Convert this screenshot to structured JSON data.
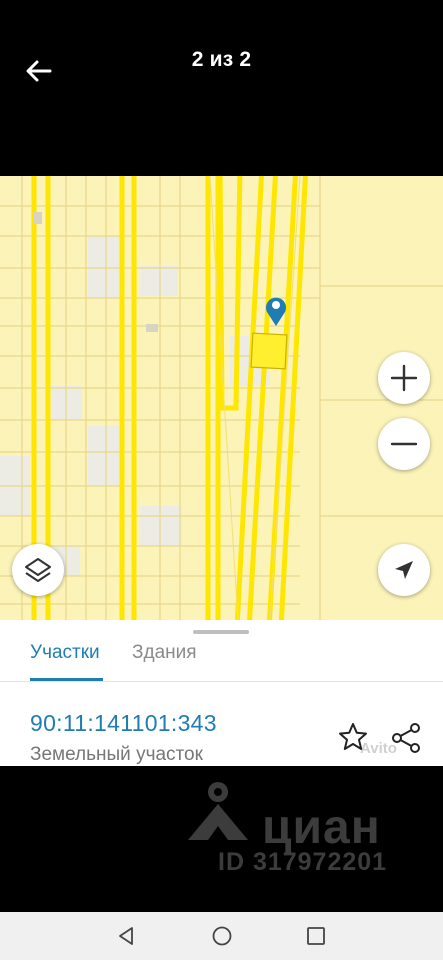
{
  "header": {
    "counter": "2 из 2",
    "back_icon": "arrow-left-icon"
  },
  "map": {
    "controls": {
      "zoom_in_icon": "plus-icon",
      "zoom_out_icon": "minus-icon",
      "layers_icon": "layers-icon",
      "locate_icon": "navigation-arrow-icon"
    },
    "marker_icon": "map-pin-icon",
    "colors": {
      "background": "#fbf3b8",
      "road_border": "#ffe600",
      "parcel_line": "#e9d98c",
      "marker": "#1f7db4",
      "selected_plot": "#ffef2e"
    }
  },
  "sheet": {
    "tabs": [
      {
        "label": "Участки",
        "active": true
      },
      {
        "label": "Здания",
        "active": false
      }
    ],
    "cadastral_number": "90:11:141101:343",
    "plot_type": "Земельный участок",
    "star_icon": "star-icon",
    "share_icon": "share-icon",
    "avito_watermark": "Avito"
  },
  "watermark": {
    "brand": "циан",
    "listing_id": "ID 317972201",
    "logo_icon": "cian-logo-icon"
  },
  "navbar": {
    "back_icon": "triangle-back-icon",
    "home_icon": "circle-home-icon",
    "recent_icon": "square-recent-icon"
  }
}
